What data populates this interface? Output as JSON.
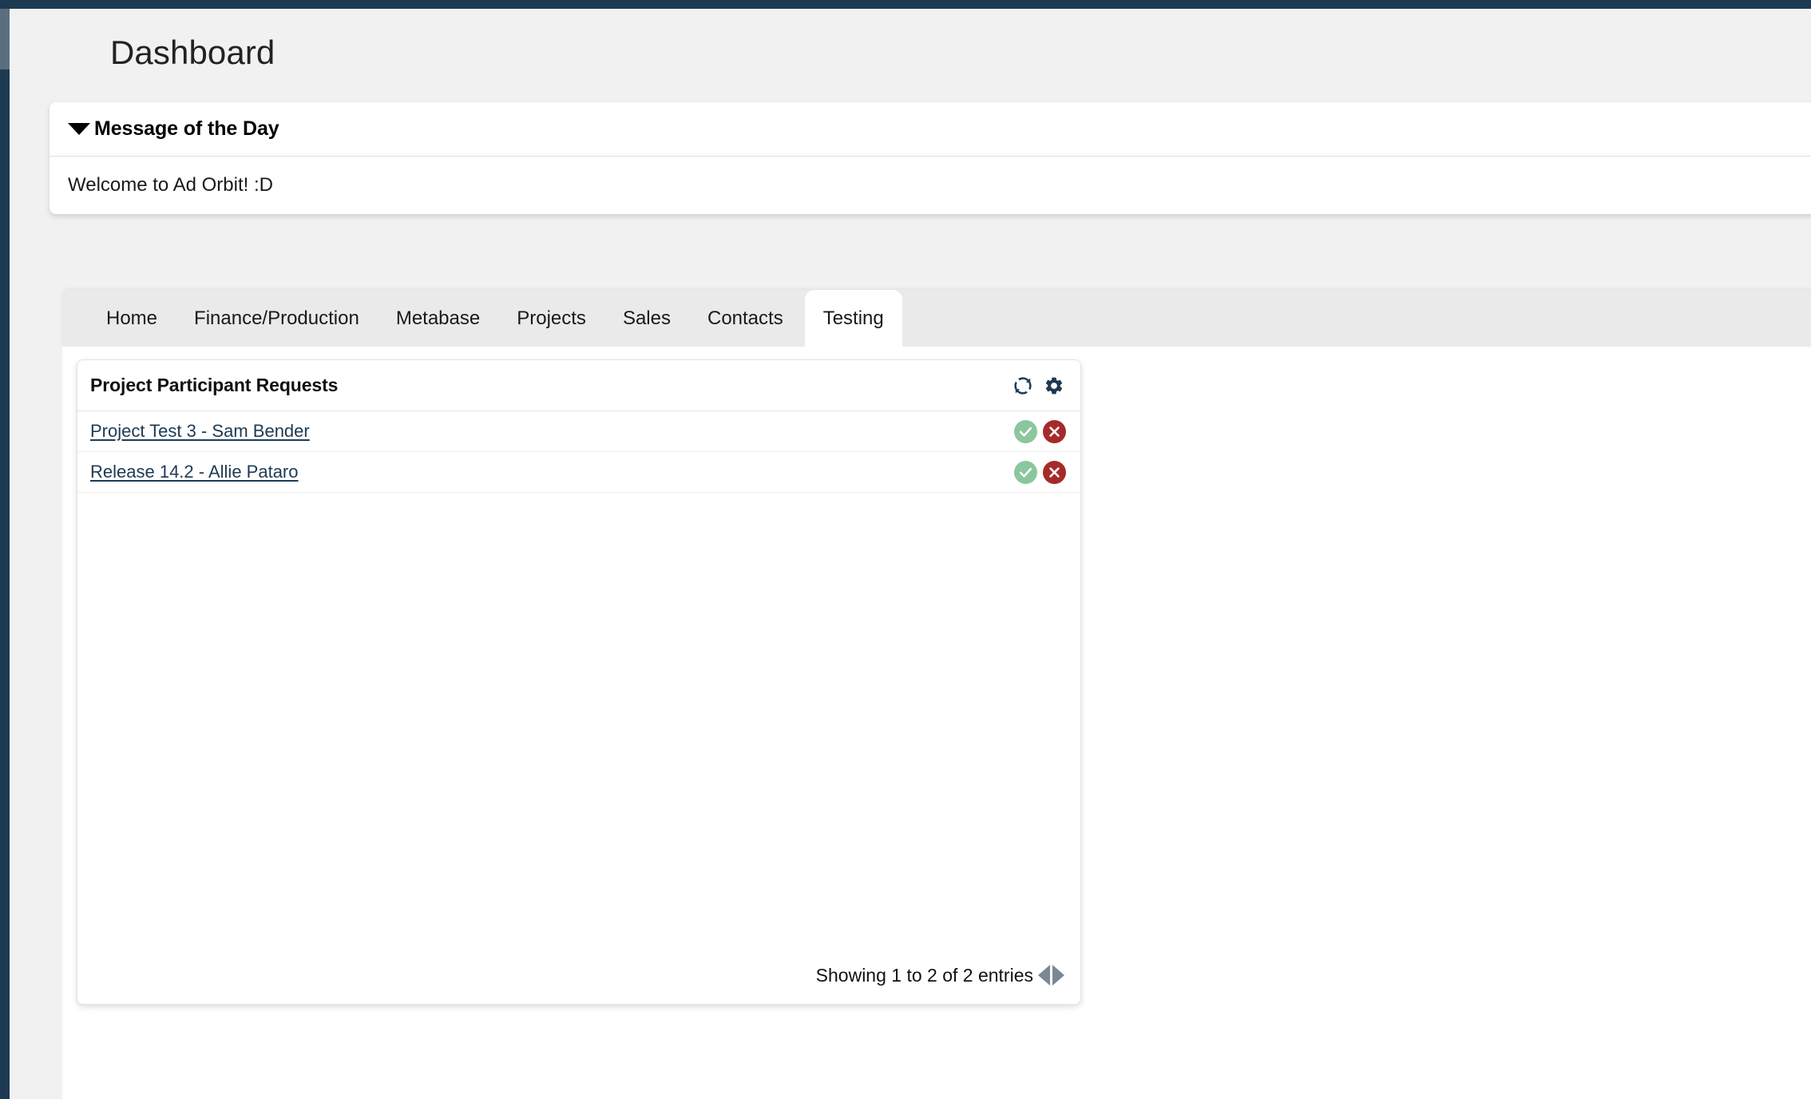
{
  "colors": {
    "brand_navy": "#1d3a52",
    "rail_highlight": "#5a6e80",
    "page_bg": "#f1f1f1",
    "tabstrip_bg": "#eaeaea",
    "approve_green": "#8cc69e",
    "reject_red": "#a52a2a",
    "pager_gray": "#7b8794",
    "link_navy": "#1d3a52"
  },
  "page": {
    "title": "Dashboard"
  },
  "motd": {
    "caret_icon": "caret-down-icon",
    "title": "Message of the Day",
    "message": "Welcome to Ad Orbit! :D"
  },
  "tabs": [
    {
      "label": "Home",
      "active": false
    },
    {
      "label": "Finance/Production",
      "active": false
    },
    {
      "label": "Metabase",
      "active": false
    },
    {
      "label": "Projects",
      "active": false
    },
    {
      "label": "Sales",
      "active": false
    },
    {
      "label": "Contacts",
      "active": false
    },
    {
      "label": "Testing",
      "active": true
    }
  ],
  "widget": {
    "title": "Project Participant Requests",
    "tools": [
      {
        "name": "refresh-icon",
        "label": "Refresh"
      },
      {
        "name": "gear-icon",
        "label": "Settings"
      }
    ],
    "rows": [
      {
        "label": "Project Test 3 - Sam Bender",
        "approve_icon": "check-circle-icon",
        "reject_icon": "x-circle-icon"
      },
      {
        "label": "Release 14.2 - Allie Pataro",
        "approve_icon": "check-circle-icon",
        "reject_icon": "x-circle-icon"
      }
    ],
    "footer": {
      "entries_text": "Showing 1 to 2 of 2 entries",
      "prev_icon": "triangle-left-icon",
      "next_icon": "triangle-right-icon"
    }
  }
}
